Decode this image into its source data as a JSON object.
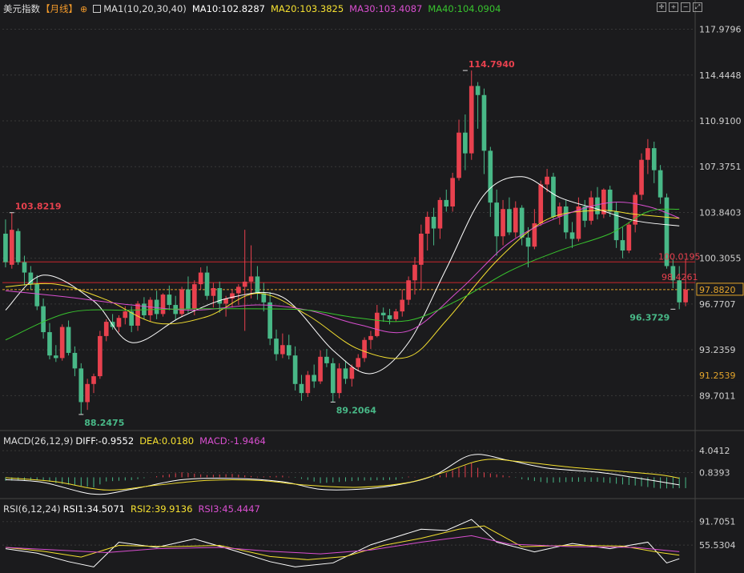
{
  "header": {
    "symbol": "美元指数",
    "period": "【月线】",
    "indicator": "MA1(10,20,30,40)",
    "ma10": "MA10:102.8287",
    "ma20": "MA20:103.3825",
    "ma30": "MA30:103.4087",
    "ma40": "MA40:104.0904"
  },
  "macd_header": {
    "label": "MACD(26,12,9)",
    "diff": "DIFF:-0.9552",
    "dea": "DEA:0.0180",
    "macd": "MACD:-1.9464"
  },
  "rsi_header": {
    "label": "RSI(6,12,24)",
    "rsi1": "RSI1:34.5071",
    "rsi2": "RSI2:39.9136",
    "rsi3": "RSI3:45.4447"
  },
  "colors": {
    "up": "#e8414e",
    "down": "#48b887",
    "ma10": "#ffffff",
    "ma20": "#f5e030",
    "ma30": "#d94fd0",
    "ma40": "#38c42e",
    "bg": "#1b1b1d",
    "grid": "#383838"
  },
  "annotations": {
    "high_left": "103.8219",
    "low_left": "88.2475",
    "low_mid": "89.2064",
    "high_peak": "114.7940",
    "low_right": "96.3729"
  },
  "price_lines": {
    "line1": "100.0195",
    "line2": "98.4261",
    "current": "97.8820",
    "axis_extra": "91.2539"
  },
  "chart_data": {
    "type": "candlestick",
    "period": "monthly",
    "y_ticks": [
      "117.9796",
      "114.4448",
      "110.9100",
      "107.3751",
      "103.8403",
      "100.3055",
      "96.7707",
      "93.2359",
      "89.7011"
    ],
    "ylim": [
      87.5,
      119.0
    ],
    "candles": [
      [
        102.2,
        103.3,
        99.6,
        100.0
      ],
      [
        99.8,
        103.82,
        99.5,
        102.5
      ],
      [
        102.4,
        102.6,
        99.8,
        100.0
      ],
      [
        100.0,
        100.5,
        98.2,
        99.2
      ],
      [
        99.2,
        99.7,
        97.9,
        98.3
      ],
      [
        98.3,
        99.0,
        96.3,
        96.6
      ],
      [
        96.6,
        97.2,
        94.1,
        94.6
      ],
      [
        94.6,
        95.3,
        92.5,
        92.8
      ],
      [
        92.8,
        93.6,
        92.3,
        92.6
      ],
      [
        92.6,
        95.2,
        92.4,
        95.0
      ],
      [
        95.0,
        95.5,
        92.8,
        93.0
      ],
      [
        93.0,
        93.5,
        91.2,
        91.8
      ],
      [
        91.8,
        92.2,
        88.2475,
        89.2
      ],
      [
        89.2,
        91.0,
        88.6,
        90.6
      ],
      [
        90.6,
        91.4,
        89.9,
        91.2
      ],
      [
        91.2,
        94.7,
        91.0,
        94.3
      ],
      [
        94.3,
        95.6,
        93.9,
        95.4
      ],
      [
        95.4,
        96.0,
        94.8,
        95.0
      ],
      [
        95.0,
        95.9,
        94.6,
        95.7
      ],
      [
        95.7,
        96.6,
        95.2,
        96.2
      ],
      [
        96.2,
        96.6,
        94.6,
        95.1
      ],
      [
        95.1,
        97.0,
        94.7,
        96.8
      ],
      [
        96.8,
        97.3,
        95.6,
        95.9
      ],
      [
        95.9,
        97.3,
        95.4,
        97.1
      ],
      [
        97.1,
        97.8,
        95.6,
        96.0
      ],
      [
        96.0,
        97.6,
        95.8,
        97.5
      ],
      [
        97.5,
        98.2,
        96.3,
        96.7
      ],
      [
        96.7,
        97.4,
        95.5,
        96.0
      ],
      [
        96.0,
        98.1,
        95.8,
        97.9
      ],
      [
        97.9,
        98.9,
        96.1,
        96.4
      ],
      [
        96.4,
        98.6,
        95.9,
        98.3
      ],
      [
        98.3,
        99.6,
        97.9,
        99.2
      ],
      [
        99.2,
        99.7,
        97.1,
        97.4
      ],
      [
        97.4,
        98.4,
        96.5,
        98.0
      ],
      [
        98.0,
        98.5,
        96.1,
        96.8
      ],
      [
        96.8,
        97.4,
        95.8,
        97.2
      ],
      [
        97.2,
        97.9,
        96.5,
        97.6
      ],
      [
        97.6,
        98.3,
        96.7,
        98.1
      ],
      [
        98.1,
        102.5,
        94.7,
        98.5
      ],
      [
        98.5,
        101.3,
        97.2,
        98.9
      ],
      [
        98.9,
        99.7,
        97.1,
        97.6
      ],
      [
        97.6,
        98.4,
        96.2,
        96.9
      ],
      [
        96.9,
        97.7,
        93.6,
        94.1
      ],
      [
        94.1,
        94.8,
        92.4,
        92.9
      ],
      [
        92.9,
        94.5,
        92.6,
        93.6
      ],
      [
        93.6,
        94.4,
        92.5,
        92.8
      ],
      [
        92.8,
        93.5,
        90.1,
        90.6
      ],
      [
        90.6,
        91.3,
        89.3,
        89.9
      ],
      [
        89.9,
        91.6,
        89.6,
        91.3
      ],
      [
        91.3,
        92.1,
        90.3,
        90.8
      ],
      [
        90.8,
        93.2,
        90.6,
        92.7
      ],
      [
        92.7,
        93.3,
        91.9,
        92.2
      ],
      [
        92.2,
        92.6,
        89.2064,
        89.9
      ],
      [
        89.9,
        92.2,
        89.5,
        91.8
      ],
      [
        91.8,
        92.4,
        90.6,
        91.0
      ],
      [
        91.0,
        92.1,
        90.4,
        91.9
      ],
      [
        91.9,
        92.9,
        91.6,
        92.6
      ],
      [
        92.6,
        94.2,
        92.3,
        94.0
      ],
      [
        94.0,
        94.7,
        93.3,
        94.3
      ],
      [
        94.3,
        96.7,
        94.2,
        96.1
      ],
      [
        96.1,
        96.5,
        95.4,
        95.9
      ],
      [
        95.9,
        96.4,
        95.2,
        95.6
      ],
      [
        95.6,
        96.4,
        95.4,
        96.2
      ],
      [
        96.2,
        97.9,
        95.8,
        97.1
      ],
      [
        97.1,
        98.9,
        96.7,
        98.6
      ],
      [
        98.6,
        100.4,
        97.5,
        99.8
      ],
      [
        99.8,
        102.9,
        97.9,
        102.2
      ],
      [
        102.2,
        103.9,
        100.9,
        103.5
      ],
      [
        103.5,
        104.2,
        101.3,
        102.6
      ],
      [
        102.6,
        105.0,
        101.8,
        104.8
      ],
      [
        104.8,
        105.6,
        103.9,
        104.3
      ],
      [
        104.3,
        106.9,
        103.9,
        106.5
      ],
      [
        106.5,
        111.0,
        106.3,
        110.0
      ],
      [
        110.0,
        111.4,
        107.1,
        108.4
      ],
      [
        108.4,
        114.794,
        107.9,
        113.6
      ],
      [
        113.6,
        113.9,
        110.3,
        112.9
      ],
      [
        112.9,
        113.4,
        106.8,
        108.6
      ],
      [
        108.6,
        108.9,
        103.5,
        104.6
      ],
      [
        104.6,
        105.6,
        100.5,
        102.0
      ],
      [
        102.0,
        104.8,
        101.3,
        104.1
      ],
      [
        104.1,
        105.0,
        102.1,
        102.3
      ],
      [
        102.3,
        104.7,
        101.9,
        104.2
      ],
      [
        104.2,
        104.4,
        101.3,
        101.9
      ],
      [
        101.9,
        102.7,
        99.6,
        101.2
      ],
      [
        101.2,
        104.1,
        101.0,
        103.0
      ],
      [
        103.0,
        106.3,
        102.8,
        106.0
      ],
      [
        106.0,
        107.2,
        105.4,
        106.6
      ],
      [
        106.6,
        106.9,
        103.3,
        103.5
      ],
      [
        103.5,
        104.6,
        102.9,
        104.3
      ],
      [
        104.3,
        104.8,
        101.8,
        102.3
      ],
      [
        102.3,
        103.1,
        101.1,
        101.8
      ],
      [
        101.8,
        105.0,
        101.6,
        104.3
      ],
      [
        104.3,
        104.8,
        102.7,
        103.2
      ],
      [
        103.2,
        105.5,
        102.9,
        105.0
      ],
      [
        105.0,
        105.8,
        103.3,
        103.7
      ],
      [
        103.7,
        105.7,
        103.4,
        105.6
      ],
      [
        105.6,
        105.9,
        103.5,
        103.9
      ],
      [
        103.9,
        104.6,
        101.1,
        101.7
      ],
      [
        101.7,
        102.7,
        100.3,
        100.9
      ],
      [
        100.9,
        103.1,
        100.7,
        102.9
      ],
      [
        102.9,
        105.4,
        102.3,
        105.2
      ],
      [
        105.2,
        108.4,
        104.8,
        107.9
      ],
      [
        107.9,
        109.5,
        106.8,
        108.8
      ],
      [
        108.8,
        109.3,
        106.1,
        107.1
      ],
      [
        107.1,
        107.5,
        104.5,
        105.0
      ],
      [
        105.0,
        105.3,
        99.5,
        99.7
      ],
      [
        99.7,
        100.2,
        98.0,
        98.6
      ],
      [
        98.6,
        99.7,
        96.3729,
        96.9
      ],
      [
        96.9,
        100.2,
        96.6,
        97.88
      ]
    ],
    "ma_series": [
      {
        "name": "MA10",
        "color": "#ffffff",
        "points": [
          [
            0,
            96.3
          ],
          [
            6,
            99.0
          ],
          [
            14,
            97.0
          ],
          [
            20,
            93.8
          ],
          [
            28,
            95.8
          ],
          [
            36,
            97.3
          ],
          [
            44,
            97.3
          ],
          [
            52,
            93.2
          ],
          [
            58,
            91.4
          ],
          [
            64,
            93.8
          ],
          [
            70,
            99.5
          ],
          [
            76,
            105.2
          ],
          [
            82,
            106.6
          ],
          [
            88,
            105.0
          ],
          [
            94,
            104.1
          ],
          [
            100,
            103.2
          ],
          [
            107,
            102.8
          ]
        ]
      },
      {
        "name": "MA20",
        "color": "#f5e030",
        "points": [
          [
            0,
            98.1
          ],
          [
            8,
            98.3
          ],
          [
            16,
            97.1
          ],
          [
            24,
            95.3
          ],
          [
            32,
            95.8
          ],
          [
            40,
            97.6
          ],
          [
            48,
            95.9
          ],
          [
            56,
            93.3
          ],
          [
            64,
            92.7
          ],
          [
            70,
            95.5
          ],
          [
            78,
            100.1
          ],
          [
            86,
            103.3
          ],
          [
            94,
            104.0
          ],
          [
            100,
            103.7
          ],
          [
            107,
            103.38
          ]
        ]
      },
      {
        "name": "MA30",
        "color": "#d94fd0",
        "points": [
          [
            0,
            97.8
          ],
          [
            10,
            97.3
          ],
          [
            20,
            96.7
          ],
          [
            30,
            96.3
          ],
          [
            40,
            96.7
          ],
          [
            48,
            96.3
          ],
          [
            56,
            95.2
          ],
          [
            64,
            94.7
          ],
          [
            72,
            97.8
          ],
          [
            80,
            101.5
          ],
          [
            88,
            103.5
          ],
          [
            96,
            104.6
          ],
          [
            102,
            104.3
          ],
          [
            107,
            103.41
          ]
        ]
      },
      {
        "name": "MA40",
        "color": "#38c42e",
        "points": [
          [
            0,
            94.0
          ],
          [
            10,
            96.1
          ],
          [
            20,
            96.3
          ],
          [
            30,
            96.4
          ],
          [
            40,
            96.4
          ],
          [
            48,
            96.3
          ],
          [
            56,
            95.7
          ],
          [
            64,
            95.5
          ],
          [
            72,
            97.1
          ],
          [
            80,
            99.3
          ],
          [
            88,
            100.9
          ],
          [
            96,
            102.2
          ],
          [
            102,
            103.9
          ],
          [
            107,
            104.09
          ]
        ]
      }
    ],
    "macd": {
      "y_ticks": [
        "4.0412",
        "0.8393"
      ],
      "diff": [
        [
          0,
          -0.2
        ],
        [
          6,
          -0.6
        ],
        [
          14,
          -2.3
        ],
        [
          20,
          -1.6
        ],
        [
          28,
          -0.2
        ],
        [
          36,
          0.0
        ],
        [
          44,
          -0.5
        ],
        [
          50,
          -1.6
        ],
        [
          56,
          -1.6
        ],
        [
          62,
          -1.0
        ],
        [
          68,
          0.4
        ],
        [
          74,
          3.4
        ],
        [
          80,
          2.6
        ],
        [
          86,
          1.5
        ],
        [
          94,
          0.9
        ],
        [
          100,
          0.1
        ],
        [
          107,
          -0.95
        ]
      ],
      "dea": [
        [
          0,
          0.1
        ],
        [
          8,
          -0.5
        ],
        [
          16,
          -1.7
        ],
        [
          24,
          -1.0
        ],
        [
          32,
          -0.3
        ],
        [
          40,
          -0.3
        ],
        [
          48,
          -1.0
        ],
        [
          56,
          -1.3
        ],
        [
          64,
          -0.6
        ],
        [
          70,
          1.0
        ],
        [
          76,
          2.7
        ],
        [
          82,
          2.4
        ],
        [
          90,
          1.6
        ],
        [
          98,
          1.0
        ],
        [
          104,
          0.5
        ],
        [
          107,
          0.018
        ]
      ]
    },
    "rsi": {
      "y_ticks": [
        "91.7051",
        "55.5304"
      ],
      "rsi1": [
        [
          0,
          50
        ],
        [
          5,
          43
        ],
        [
          10,
          30
        ],
        [
          14,
          22
        ],
        [
          18,
          60
        ],
        [
          24,
          52
        ],
        [
          30,
          65
        ],
        [
          36,
          48
        ],
        [
          42,
          30
        ],
        [
          46,
          22
        ],
        [
          52,
          28
        ],
        [
          58,
          56
        ],
        [
          62,
          68
        ],
        [
          66,
          80
        ],
        [
          70,
          78
        ],
        [
          74,
          95
        ],
        [
          78,
          60
        ],
        [
          84,
          45
        ],
        [
          90,
          58
        ],
        [
          96,
          50
        ],
        [
          102,
          60
        ],
        [
          105,
          28
        ],
        [
          107,
          34.5
        ]
      ],
      "rsi2": [
        [
          0,
          52
        ],
        [
          6,
          46
        ],
        [
          12,
          37
        ],
        [
          18,
          55
        ],
        [
          26,
          53
        ],
        [
          34,
          55
        ],
        [
          42,
          38
        ],
        [
          48,
          33
        ],
        [
          54,
          38
        ],
        [
          60,
          55
        ],
        [
          66,
          66
        ],
        [
          72,
          80
        ],
        [
          76,
          85
        ],
        [
          82,
          53
        ],
        [
          90,
          55
        ],
        [
          98,
          54
        ],
        [
          104,
          44
        ],
        [
          107,
          39.9
        ]
      ],
      "rsi3": [
        [
          0,
          52
        ],
        [
          8,
          48
        ],
        [
          16,
          44
        ],
        [
          24,
          50
        ],
        [
          34,
          52
        ],
        [
          42,
          46
        ],
        [
          50,
          42
        ],
        [
          58,
          48
        ],
        [
          66,
          60
        ],
        [
          74,
          70
        ],
        [
          80,
          57
        ],
        [
          90,
          53
        ],
        [
          100,
          52
        ],
        [
          107,
          45.4
        ]
      ]
    }
  }
}
